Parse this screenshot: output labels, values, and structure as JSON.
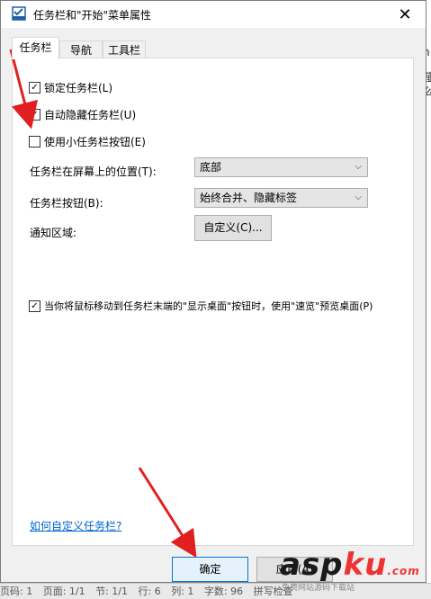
{
  "background": {
    "right_edge_chars": [
      "n",
      "薤",
      "么"
    ],
    "status_bar": [
      "页码: 1",
      "页面: 1/1",
      "节: 1/1",
      "行: 6",
      "列: 1",
      "字数: 96",
      "拼写检查"
    ]
  },
  "watermark": {
    "brand_main": "asp",
    "brand_accent": "ku",
    "brand_suffix": ".com",
    "sub_text": "免费网站源码下载站"
  },
  "dialog": {
    "title": "任务栏和\"开始\"菜单属性",
    "close_glyph": "✕",
    "tabs": [
      "任务栏",
      "导航",
      "工具栏"
    ],
    "options": {
      "lock_taskbar": {
        "label": "锁定任务栏(L)",
        "checked": true
      },
      "auto_hide": {
        "label": "自动隐藏任务栏(U)",
        "checked": true
      },
      "small_buttons": {
        "label": "使用小任务栏按钮(E)",
        "checked": false
      },
      "peek": {
        "label": "当你将鼠标移动到任务栏末端的\"显示桌面\"按钮时，使用\"速览\"预览桌面(P)",
        "checked": true
      }
    },
    "position": {
      "label": "任务栏在屏幕上的位置(T):",
      "value": "底部"
    },
    "buttons_mode": {
      "label": "任务栏按钮(B):",
      "value": "始终合并、隐藏标签"
    },
    "notify": {
      "label": "通知区域:",
      "button": "自定义(C)..."
    },
    "help_link": "如何自定义任务栏?",
    "ok_button": "确定",
    "apply_button": "应用(A)"
  }
}
